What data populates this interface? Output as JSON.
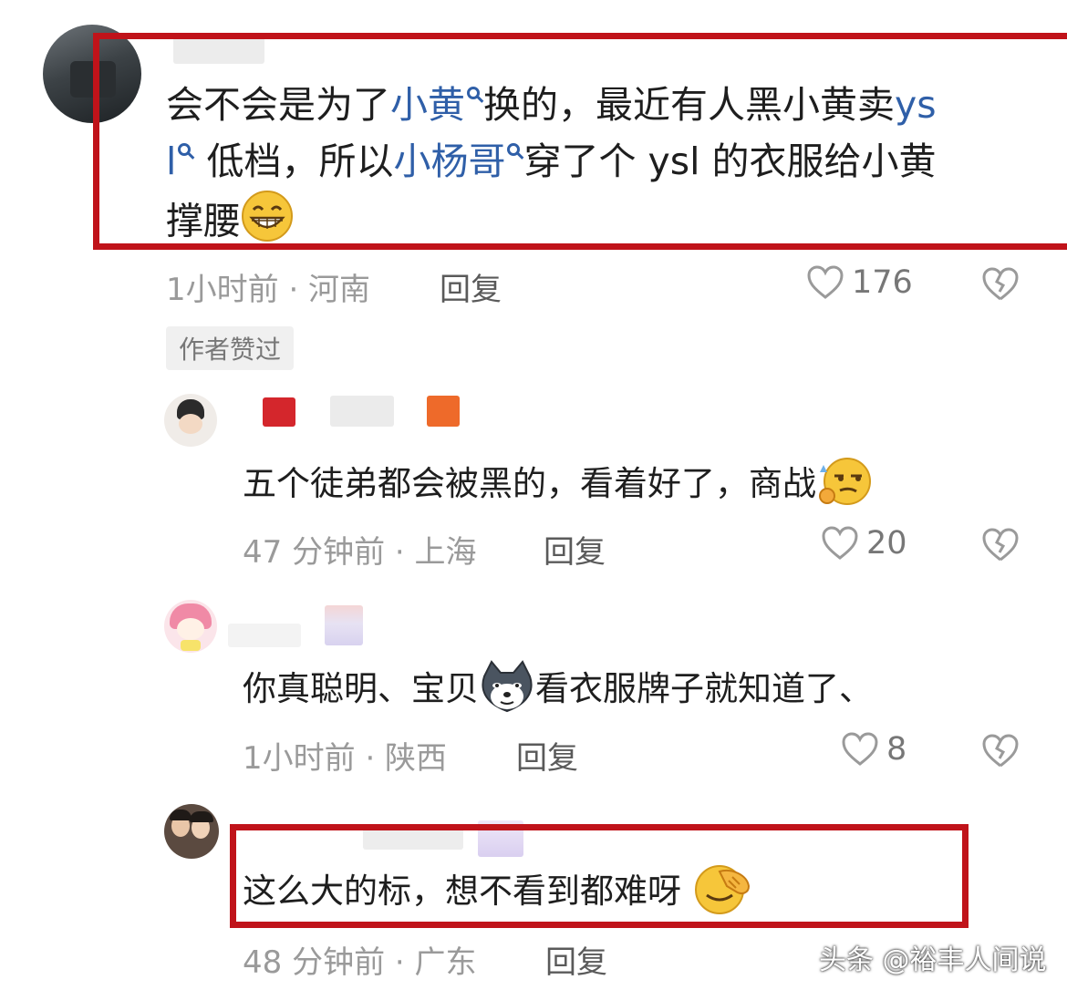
{
  "comments": [
    {
      "text_parts": {
        "p1": "会不会是为了",
        "link1": "小黄",
        "p2": "换的，最近有人黑小黄卖",
        "link2a": "ys",
        "link2b": "l",
        "p3": " 低档，所以",
        "link3": "小杨哥",
        "p4": "穿了个 ysl 的衣服给小黄",
        "p5": "撑腰"
      },
      "meta": "1小时前 · 河南",
      "reply_label": "回复",
      "likes": "176",
      "badge": "作者赞过"
    },
    {
      "text": "五个徒弟都会被黑的，看着好了，商战",
      "meta": "47 分钟前 · 上海",
      "reply_label": "回复",
      "likes": "20"
    },
    {
      "text_a": "你真聪明、宝贝",
      "text_b": "看衣服牌子就知道了、",
      "meta": "1小时前 · 陕西",
      "reply_label": "回复",
      "likes": "8"
    },
    {
      "text": "这么大的标，想不看到都难呀",
      "meta": "48 分钟前 · 广东",
      "reply_label": "回复"
    }
  ],
  "watermark": "头条 @裕丰人间说",
  "colors": {
    "highlight": "#c0131a",
    "link": "#2f5fa8",
    "meta": "#9a9a9a"
  }
}
